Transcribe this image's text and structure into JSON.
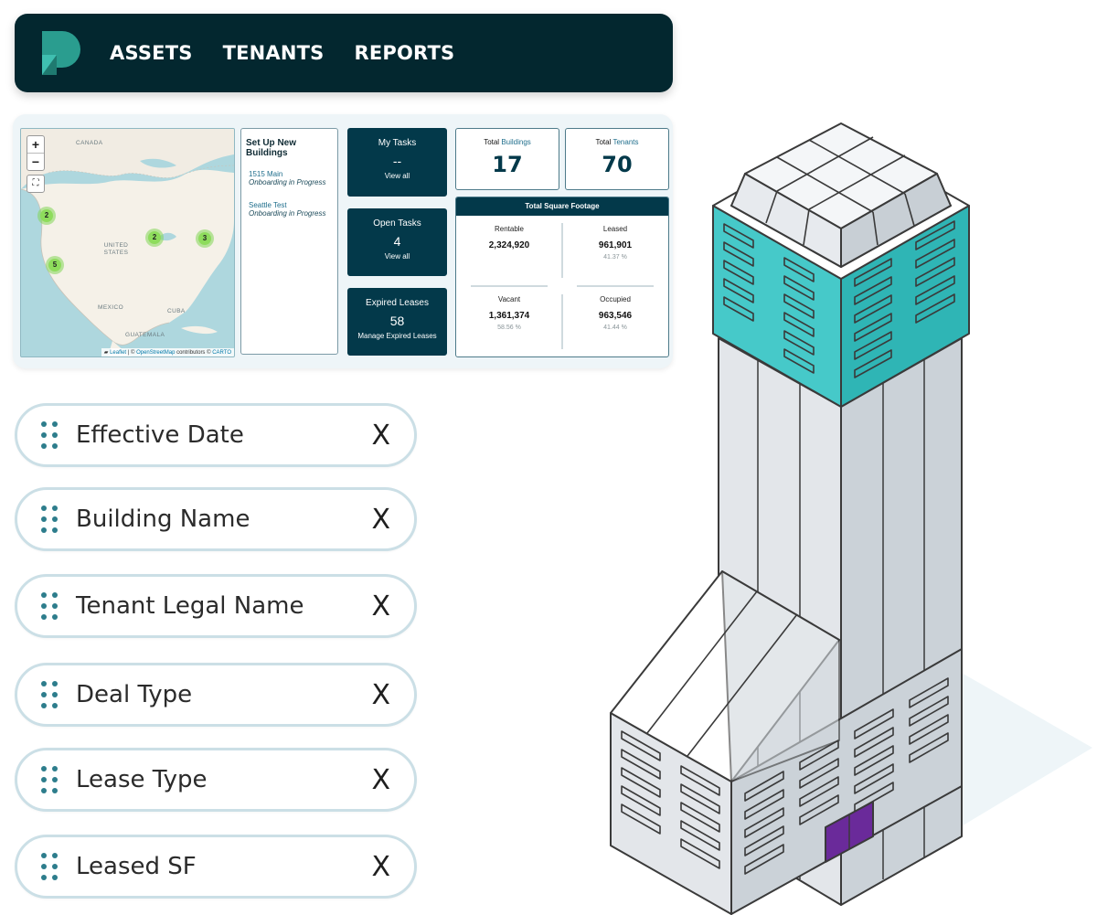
{
  "nav": {
    "logo": "logo-icon",
    "items": [
      "ASSETS",
      "TENANTS",
      "REPORTS"
    ]
  },
  "map": {
    "zoom_in": "+",
    "zoom_out": "−",
    "labels": {
      "canada": "CANADA",
      "united_states": "UNITED STATES",
      "mexico": "MEXICO",
      "cuba": "CUBA",
      "guatemala": "GUATEMALA"
    },
    "clusters": [
      "2",
      "2",
      "3",
      "5"
    ],
    "attribution": {
      "leaflet": "Leaflet",
      "sep1": " | © ",
      "osm": "OpenStreetMap",
      "contributors": " contributors © ",
      "carto": "CARTO"
    }
  },
  "setup": {
    "title": "Set Up New Buildings",
    "buildings": [
      {
        "name": "1515 Main",
        "status": "Onboarding in Progress"
      },
      {
        "name": "Seattle Test",
        "status": "Onboarding in Progress"
      }
    ]
  },
  "tiles": [
    {
      "title": "My Tasks",
      "value": "--",
      "link": "View all"
    },
    {
      "title": "Open Tasks",
      "value": "4",
      "link": "View all"
    },
    {
      "title": "Expired Leases",
      "value": "58",
      "link": "Manage Expired Leases"
    }
  ],
  "totals": {
    "buildings": {
      "prefix": "Total",
      "label": "Buildings",
      "value": "17"
    },
    "tenants": {
      "prefix": "Total",
      "label": "Tenants",
      "value": "70"
    }
  },
  "sqft": {
    "title": "Total Square Footage",
    "rentable": {
      "label": "Rentable",
      "value": "2,324,920"
    },
    "leased": {
      "label": "Leased",
      "value": "961,901",
      "pct": "41.37 %"
    },
    "vacant": {
      "label": "Vacant",
      "value": "1,361,374",
      "pct": "58.56 %"
    },
    "occupied": {
      "label": "Occupied",
      "value": "963,546",
      "pct": "41.44 %"
    }
  },
  "fields": [
    {
      "label": "Effective Date",
      "remove": "X"
    },
    {
      "label": "Building Name",
      "remove": "X"
    },
    {
      "label": "Tenant Legal Name",
      "remove": "X"
    },
    {
      "label": "Deal Type",
      "remove": "X"
    },
    {
      "label": "Lease Type",
      "remove": "X"
    },
    {
      "label": "Leased SF",
      "remove": "X"
    }
  ],
  "colors": {
    "nav_bg": "#03272f",
    "tile_bg": "#03394a",
    "accent_teal": "#46c9c9",
    "door_purple": "#6a2a9a",
    "cluster_green": "#8edc5c"
  },
  "illustration": "building-illustration"
}
